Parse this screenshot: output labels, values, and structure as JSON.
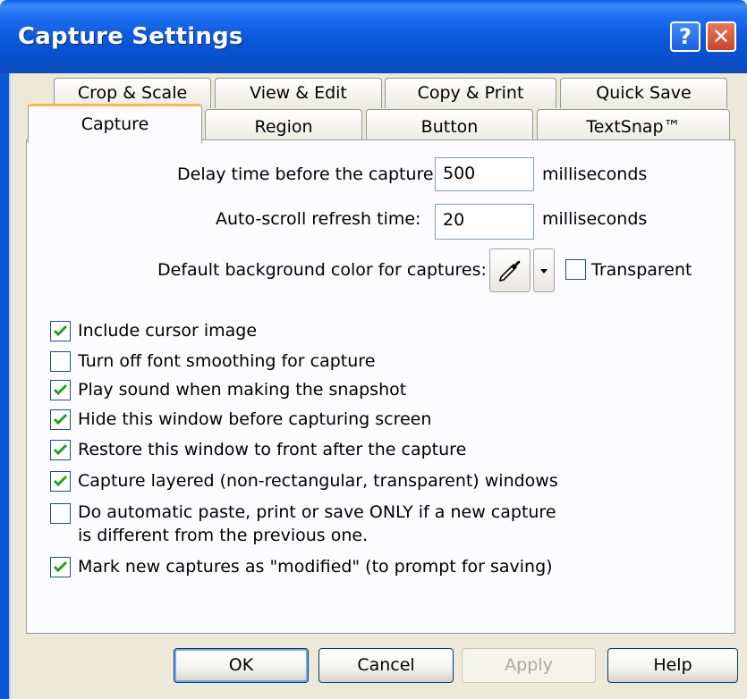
{
  "window": {
    "title": "Capture Settings"
  },
  "titlebar": {
    "help_label": "?",
    "close_label": "✕"
  },
  "tabs_row1": [
    "Crop & Scale",
    "View & Edit",
    "Copy & Print",
    "Quick Save"
  ],
  "tabs_row2": [
    "Capture",
    "Region",
    "Button",
    "TextSnap™"
  ],
  "active_tab": "Capture",
  "delay": {
    "label": "Delay time before the capture:",
    "value": "500",
    "unit": "milliseconds"
  },
  "autoscroll": {
    "label": "Auto-scroll refresh time:",
    "value": "20",
    "unit": "milliseconds"
  },
  "bgcolor": {
    "label": "Default background color for captures:",
    "transparent_label": "Transparent",
    "transparent_checked": false
  },
  "options": [
    {
      "label": "Include cursor image",
      "checked": true
    },
    {
      "label": "Turn off font smoothing for capture",
      "checked": false
    },
    {
      "label": "Play sound when making the snapshot",
      "checked": true
    },
    {
      "label": "Hide this window before capturing screen",
      "checked": true
    },
    {
      "label": "Restore this window to front after the capture",
      "checked": true
    },
    {
      "label": "Capture layered (non-rectangular, transparent) windows",
      "checked": true
    },
    {
      "label": "Do automatic paste, print or save ONLY if a new capture",
      "label2": "is different from the previous one.",
      "checked": false
    },
    {
      "label": "Mark new captures as \"modified\" (to prompt for saving)",
      "checked": true
    }
  ],
  "buttons": {
    "ok": "OK",
    "cancel": "Cancel",
    "apply": "Apply",
    "help": "Help"
  },
  "colors": {
    "titlebar": "#0a57d8",
    "active_tab_accent": "#f7b74f",
    "check": "#21a121"
  }
}
